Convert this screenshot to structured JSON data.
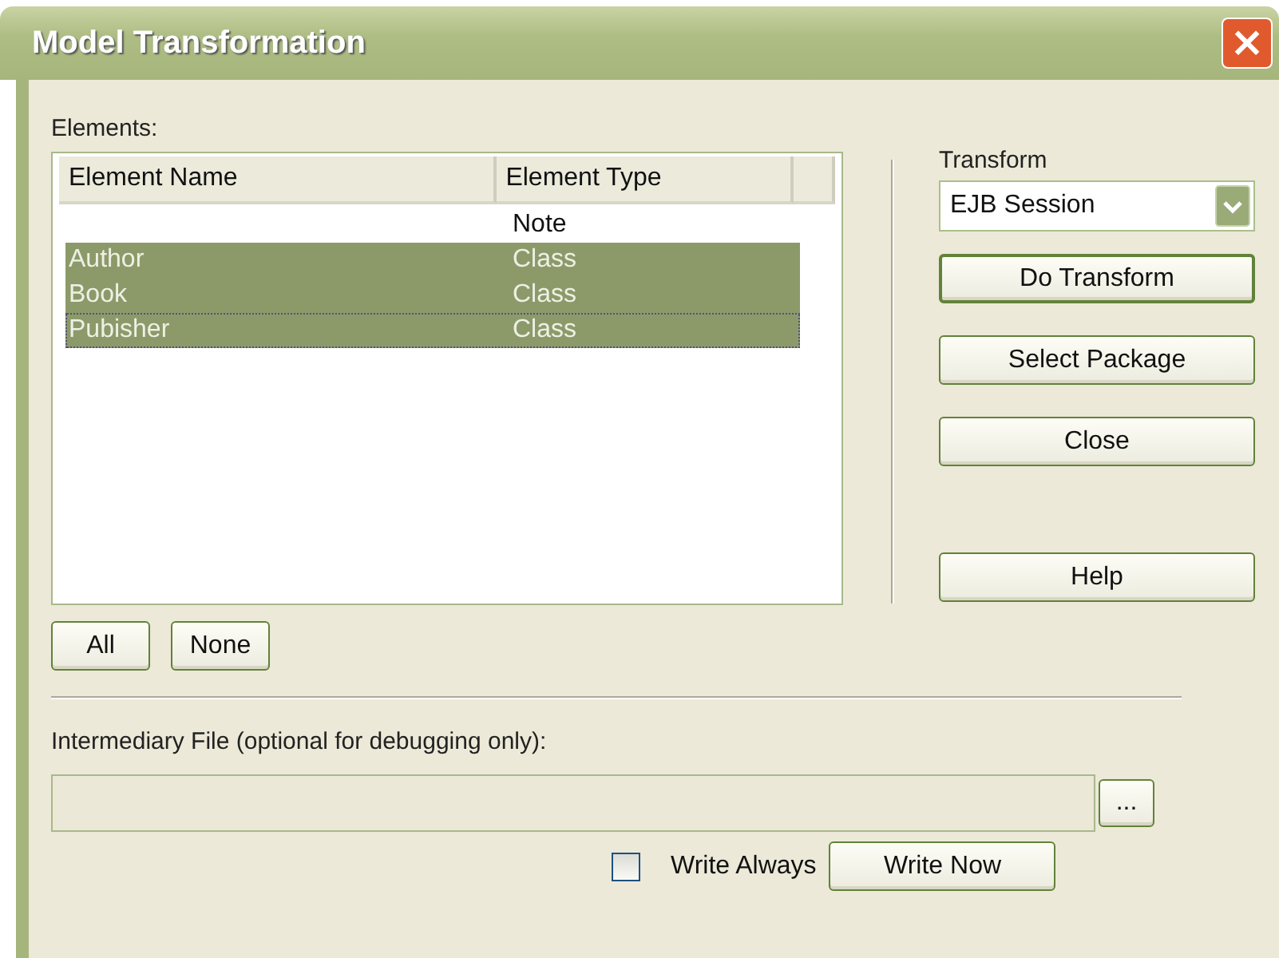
{
  "window": {
    "title": "Model Transformation",
    "close": "×"
  },
  "elements": {
    "label": "Elements:",
    "columns": [
      "Element Name",
      "Element Type"
    ],
    "rows": [
      {
        "name": "",
        "type": "Note",
        "selected": false,
        "focused": false
      },
      {
        "name": "Author",
        "type": "Class",
        "selected": true,
        "focused": false
      },
      {
        "name": "Book",
        "type": "Class",
        "selected": true,
        "focused": false
      },
      {
        "name": "Pubisher",
        "type": "Class",
        "selected": true,
        "focused": true
      }
    ],
    "buttons": [
      "All",
      "None"
    ]
  },
  "transform": {
    "label": "Transform",
    "value": "EJB Session",
    "buttons": [
      {
        "label": "Do Transform",
        "default": true
      },
      {
        "label": "Select Package",
        "default": false
      },
      {
        "label": "Close",
        "default": false
      }
    ],
    "help": "Help"
  },
  "intermediary": {
    "label": "Intermediary File (optional for debugging only):",
    "browse": "...",
    "write_always": {
      "label": "Write Always",
      "checked": false
    },
    "write_now": "Write Now"
  }
}
